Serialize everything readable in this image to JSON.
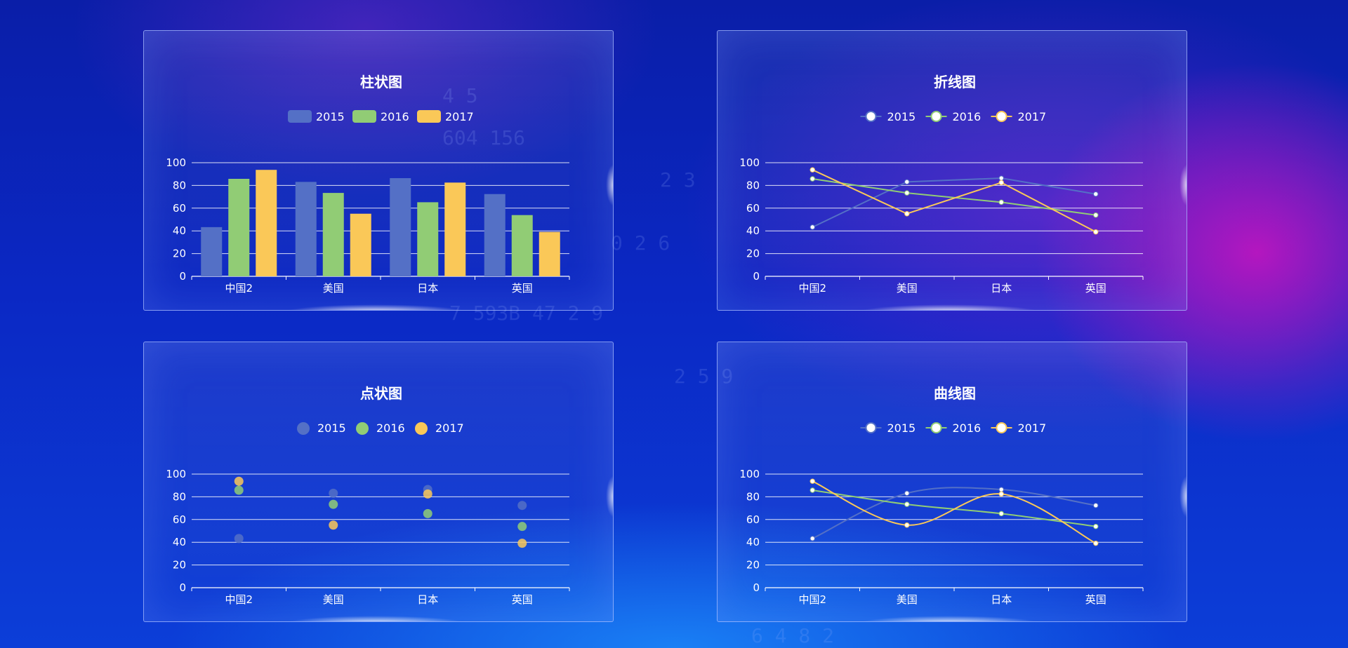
{
  "years": [
    "2015",
    "2016",
    "2017"
  ],
  "colors": {
    "2015": "#5470c6",
    "2016": "#91cc75",
    "2017": "#fac858"
  },
  "chart_data": [
    {
      "id": "p1",
      "type": "bar",
      "title": "柱状图",
      "categories": [
        "中国2",
        "美国",
        "日本",
        "英国"
      ],
      "series": [
        {
          "name": "2015",
          "values": [
            43.3,
            83.1,
            86.4,
            72.4
          ]
        },
        {
          "name": "2016",
          "values": [
            85.8,
            73.4,
            65.2,
            53.9
          ]
        },
        {
          "name": "2017",
          "values": [
            93.7,
            55.1,
            82.5,
            39.1
          ]
        }
      ],
      "ylim": [
        0,
        100
      ],
      "yticks": [
        0,
        20,
        40,
        60,
        80,
        100
      ],
      "grid": true,
      "legend": "top-center"
    },
    {
      "id": "p2",
      "type": "line",
      "title": "折线图",
      "categories": [
        "中国2",
        "美国",
        "日本",
        "英国"
      ],
      "series": [
        {
          "name": "2015",
          "values": [
            43.3,
            83.1,
            86.4,
            72.4
          ]
        },
        {
          "name": "2016",
          "values": [
            85.8,
            73.4,
            65.2,
            53.9
          ]
        },
        {
          "name": "2017",
          "values": [
            93.7,
            55.1,
            82.5,
            39.1
          ]
        }
      ],
      "ylim": [
        0,
        100
      ],
      "yticks": [
        0,
        20,
        40,
        60,
        80,
        100
      ],
      "grid": true,
      "legend": "top-center"
    },
    {
      "id": "p3",
      "type": "scatter",
      "title": "点状图",
      "categories": [
        "中国2",
        "美国",
        "日本",
        "英国"
      ],
      "series": [
        {
          "name": "2015",
          "values": [
            43.3,
            83.1,
            86.4,
            72.4
          ]
        },
        {
          "name": "2016",
          "values": [
            85.8,
            73.4,
            65.2,
            53.9
          ]
        },
        {
          "name": "2017",
          "values": [
            93.7,
            55.1,
            82.5,
            39.1
          ]
        }
      ],
      "ylim": [
        0,
        100
      ],
      "yticks": [
        0,
        20,
        40,
        60,
        80,
        100
      ],
      "grid": true,
      "legend": "top-center"
    },
    {
      "id": "p4",
      "type": "line",
      "smooth": true,
      "title": "曲线图",
      "categories": [
        "中国2",
        "美国",
        "日本",
        "英国"
      ],
      "series": [
        {
          "name": "2015",
          "values": [
            43.3,
            83.1,
            86.4,
            72.4
          ]
        },
        {
          "name": "2016",
          "values": [
            85.8,
            73.4,
            65.2,
            53.9
          ]
        },
        {
          "name": "2017",
          "values": [
            93.7,
            55.1,
            82.5,
            39.1
          ]
        }
      ],
      "ylim": [
        0,
        100
      ],
      "yticks": [
        0,
        20,
        40,
        60,
        80,
        100
      ],
      "grid": true,
      "legend": "top-center"
    }
  ]
}
